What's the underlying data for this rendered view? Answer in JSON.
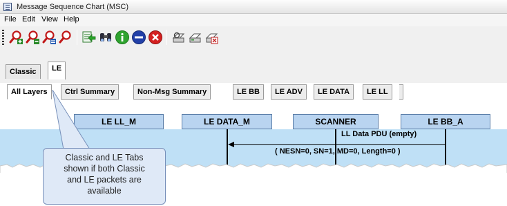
{
  "window": {
    "title": "Message Sequence Chart (MSC)"
  },
  "menu": {
    "items": [
      "File",
      "Edit",
      "View",
      "Help"
    ]
  },
  "toolbar": {
    "buttons": [
      "zoom-in-icon",
      "zoom-out-icon",
      "zoom-fit-icon",
      "zoom-reset-icon",
      "goto-icon",
      "find-icon",
      "info-icon",
      "stop-icon",
      "close-icon",
      "print-setup-icon",
      "print-icon",
      "print-preview-icon"
    ]
  },
  "outer_tabs": [
    {
      "label": "Classic"
    },
    {
      "label": "LE",
      "selected": true
    }
  ],
  "inner_tabs": [
    {
      "label": "All Layers",
      "selected": true
    },
    {
      "label": "Ctrl Summary"
    },
    {
      "label": "Non-Msg Summary"
    },
    {
      "label": "LE BB"
    },
    {
      "label": "LE ADV"
    },
    {
      "label": "LE DATA"
    },
    {
      "label": "LE LL"
    }
  ],
  "lanes": [
    {
      "label": "LE LL_M"
    },
    {
      "label": "LE DATA_M"
    },
    {
      "label": "SCANNER"
    },
    {
      "label": "LE BB_A"
    }
  ],
  "messages": {
    "top": "LL Data PDU (empty)",
    "bottom": "( NESN=0, SN=1, MD=0, Length=0 )"
  },
  "callout": {
    "lines": [
      "Classic and LE Tabs",
      "shown if both Classic",
      "and LE packets are",
      "available"
    ]
  },
  "colors": {
    "lane_fill": "#b9d4f0",
    "band_fill": "#bfe0f6",
    "callout_fill": "#dfe9f7"
  }
}
